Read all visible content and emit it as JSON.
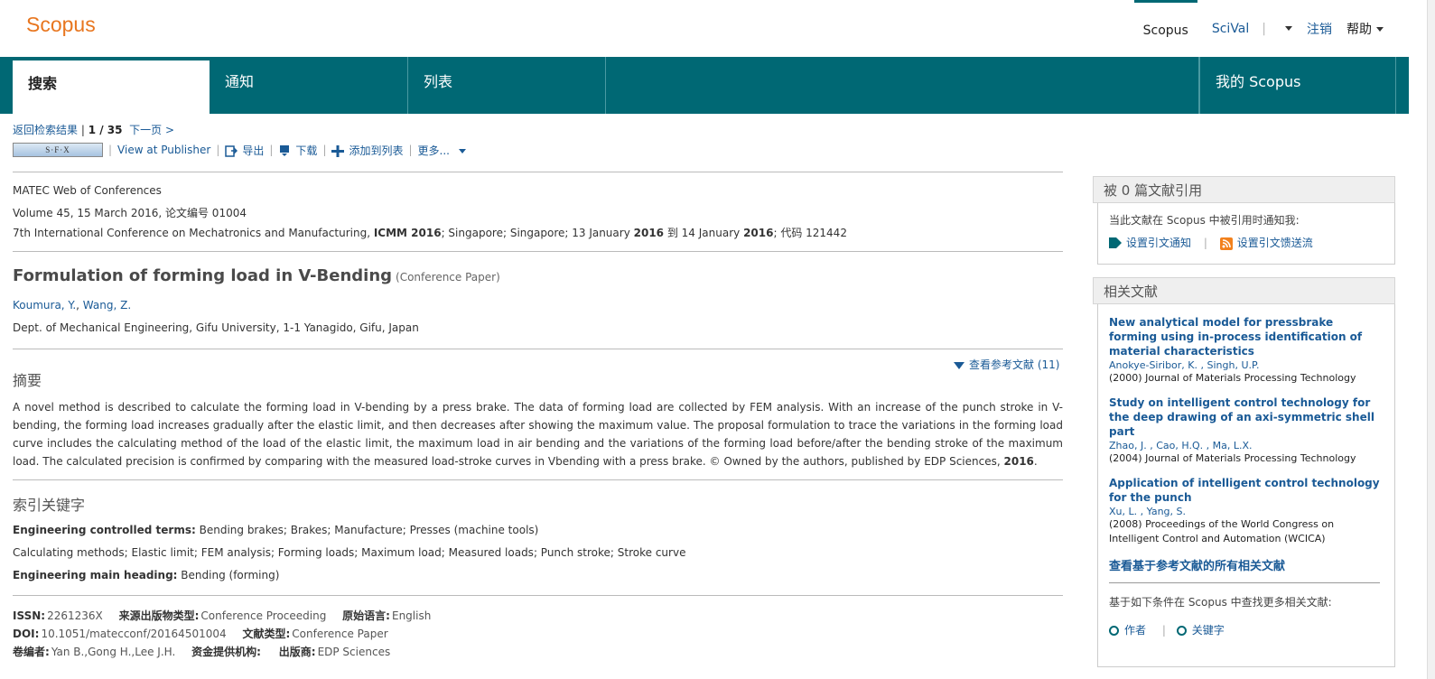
{
  "brand": {
    "logo": "Scopus"
  },
  "topnav": {
    "scopus": "Scopus",
    "scival": "SciVal",
    "sep": "|",
    "logout": "注销",
    "help": "帮助"
  },
  "tabs": [
    {
      "label": "搜索"
    },
    {
      "label": "通知"
    },
    {
      "label": "列表"
    },
    {
      "label": "我的 Scopus"
    }
  ],
  "crumbs": {
    "back": "返回检索结果",
    "sep": "|",
    "position": "1 / 35",
    "next": "下一页 >"
  },
  "toolbar": {
    "sfx": "S·F·X",
    "view_publisher": "View at Publisher",
    "export": "导出",
    "download": "下载",
    "add_list": "添加到列表",
    "more": "更多...",
    "sep": "|"
  },
  "source": {
    "journal": "MATEC Web of Conferences",
    "volume": "Volume 45, 15 March 2016, 论文编号 01004",
    "conf_a": "7th International Conference on Mechatronics and Manufacturing, ",
    "conf_b": "ICMM 2016",
    "conf_c": "; Singapore; Singapore; 13 January ",
    "conf_d": "2016",
    "conf_e": " 到 14 January ",
    "conf_f": "2016",
    "conf_g": "; 代码 121442"
  },
  "article": {
    "title": "Formulation of forming load in V-Bending",
    "type": "(Conference Paper)",
    "author1": "Koumura, Y.",
    "author2": "Wang, Z.",
    "affiliation": "Dept. of Mechanical Engineering, Gifu University, 1-1 Yanagido, Gifu, Japan"
  },
  "abstract": {
    "heading": "摘要",
    "view_refs": "查看参考文献 (11)",
    "text": "A novel method is described to calculate the forming load in V-bending by a press brake. The data of forming load are collected by FEM analysis. With an increase of the punch stroke in V-bending, the forming load increases gradually after the elastic limit, and then decreases after showing the maximum value. The proposal formulation to trace the variations in the forming load curve includes the calculating method of the load of the elastic limit, the maximum load in air bending and the variations of the forming load before/after the bending stroke of the maximum load. The calculated precision is confirmed by comparing with the measured load-stroke curves in Vbending with a press brake. © Owned by the authors, published by EDP Sciences, ",
    "year": "2016",
    "end": "."
  },
  "keywords": {
    "heading": "索引关键字",
    "controlled_label": "Engineering controlled terms:",
    "controlled": "Bending brakes; Brakes; Manufacture; Presses (machine tools)",
    "uncontrolled": "Calculating methods; Elastic limit; FEM analysis; Forming loads; Maximum load; Measured loads; Punch stroke; Stroke curve",
    "main_label": "Engineering main heading:",
    "main": "Bending (forming)"
  },
  "footer": {
    "issn_label": "ISSN:",
    "issn": "2261236X",
    "src_type_label": "来源出版物类型:",
    "src_type": "Conference Proceeding",
    "lang_label": "原始语言:",
    "lang": "English",
    "doi_label": "DOI:",
    "doi": "10.1051/matecconf/20164501004",
    "doc_type_label": "文献类型:",
    "doc_type": "Conference Paper",
    "editors_label": "卷编者:",
    "editors": "Yan B.,Gong H.,Lee J.H.",
    "funding_label": "资金提供机构:",
    "publisher_label": "出版商:",
    "publisher": "EDP Sciences"
  },
  "cited": {
    "heading": "被 0 篇文献引用",
    "notify": "当此文献在 Scopus 中被引用时通知我:",
    "set_alert": "设置引文通知",
    "sep": "|",
    "set_feed": "设置引文馈送流"
  },
  "related": {
    "heading": "相关文献",
    "items": [
      {
        "title": "New analytical model for pressbrake forming using in-process identification of material characteristics",
        "a1": "Anokye-Siribor, K.",
        "a2": "Singh, U.P.",
        "src": "(2000) Journal of Materials Processing Technology"
      },
      {
        "title": "Study on intelligent control technology for the deep drawing of an axi-symmetric shell part",
        "a1": "Zhao, J.",
        "a2": "Cao, H.Q.",
        "a3": "Ma, L.X.",
        "src": "(2004) Journal of Materials Processing Technology"
      },
      {
        "title": "Application of intelligent control technology for the punch",
        "a1": "Xu, L.",
        "a2": "Yang, S.",
        "src": "(2008) Proceedings of the World Congress on Intelligent Control and Automation (WCICA)"
      }
    ],
    "all_link": "查看基于参考文献的所有相关文献",
    "more_text": "基于如下条件在 Scopus 中查找更多相关文献:",
    "author_link": "作者",
    "sep": "|",
    "keyword_link": "关键字"
  }
}
